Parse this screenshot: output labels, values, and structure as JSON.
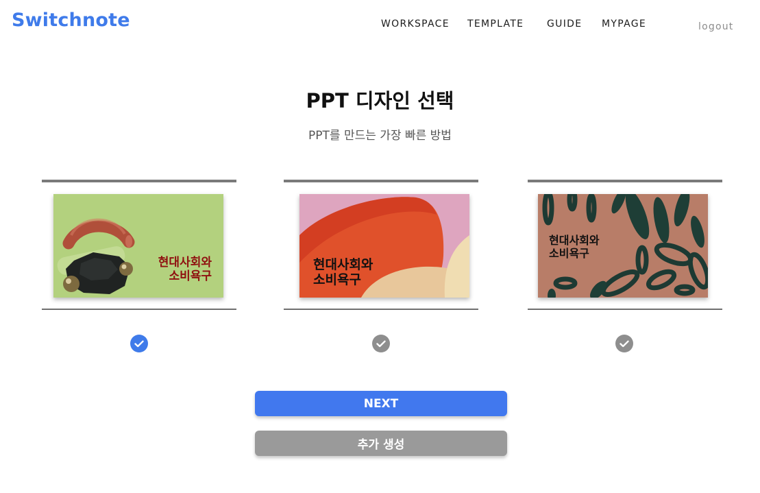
{
  "header": {
    "logo": "Switchnote",
    "nav": [
      "WORKSPACE",
      "TEMPLATE",
      "GUIDE",
      "MYPAGE"
    ],
    "logout": "logout"
  },
  "page": {
    "title": "PPT 디자인 선택",
    "subtitle": "PPT를 만드는 가장 빠른 방법"
  },
  "designs": [
    {
      "line1": "현대사회와",
      "line2": "소비욕구",
      "selected": true
    },
    {
      "line1": "현대사회와",
      "line2": "소비욕구",
      "selected": false
    },
    {
      "line1": "현대사회와",
      "line2": "소비욕구",
      "selected": false
    }
  ],
  "buttons": {
    "next": "NEXT",
    "add": "추가 생성"
  },
  "colors": {
    "brand": "#3f7bea",
    "accent": "#4178ee",
    "selected": "#3f7bea",
    "unselected": "#8e8e8e",
    "secondary_button": "#9a9a9a",
    "design1_bg": "#b3d17e",
    "design1_text": "#8f0f0f",
    "design2_bg": "#dea5bf",
    "design3_bg": "#b87d68"
  }
}
